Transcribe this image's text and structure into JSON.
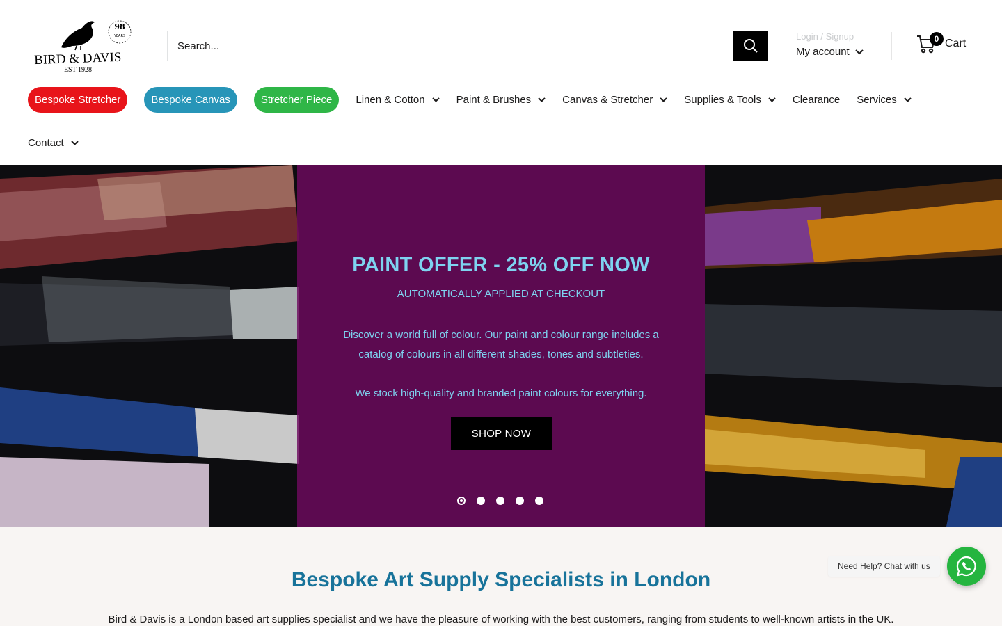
{
  "brand": {
    "name": "BIRD & DAVIS",
    "est": "EST 1928",
    "badge_number": "98",
    "badge_text": "YEARS"
  },
  "search": {
    "placeholder": "Search..."
  },
  "account": {
    "login_label": "Login / Signup",
    "my_account_label": "My account"
  },
  "cart": {
    "count": "0",
    "label": "Cart"
  },
  "nav": {
    "pills": [
      {
        "label": "Bespoke Stretcher",
        "color": "#e8141a"
      },
      {
        "label": "Bespoke Canvas",
        "color": "#2795b8"
      },
      {
        "label": "Stretcher Piece",
        "color": "#2fb647"
      }
    ],
    "items": [
      {
        "label": "Linen & Cotton",
        "has_dropdown": true
      },
      {
        "label": "Paint & Brushes",
        "has_dropdown": true
      },
      {
        "label": "Canvas & Stretcher",
        "has_dropdown": true
      },
      {
        "label": "Supplies & Tools",
        "has_dropdown": true
      },
      {
        "label": "Clearance",
        "has_dropdown": false
      },
      {
        "label": "Services",
        "has_dropdown": true
      },
      {
        "label": "Contact",
        "has_dropdown": true
      }
    ]
  },
  "hero": {
    "title": "PAINT OFFER - 25% OFF NOW",
    "subtitle": "AUTOMATICALLY APPLIED AT CHECKOUT",
    "body_1": "Discover a world full of colour. Our paint and colour range includes a catalog of colours in all different shades, tones and subtleties.",
    "body_2": "We stock high-quality and branded paint colours for everything.",
    "cta_label": "SHOP NOW",
    "slides_total": 5,
    "active_slide": 1
  },
  "intro": {
    "title": "Bespoke Art Supply Specialists in London",
    "text": "Bird & Davis is a London based art supplies specialist and we have the pleasure of working with the best customers, ranging from students to well-known artists in the UK."
  },
  "chat": {
    "label": "Need Help? Chat with us"
  },
  "colors": {
    "accent_title": "#18739a",
    "hero_text": "#7ed3f0",
    "hero_panel": "#6e0a5f",
    "whatsapp": "#25b53f"
  }
}
